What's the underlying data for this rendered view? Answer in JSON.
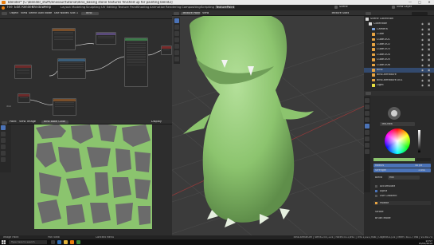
{
  "window": {
    "title": "Blender* [C:\\blender_stuff\\dinosaur\\tutorial\\dino_baking stone textures finished up for painting blend2]",
    "controls": [
      "—",
      "□",
      "✕"
    ]
  },
  "menu": [
    "File",
    "Edit",
    "Render",
    "Window",
    "Help"
  ],
  "workspaces": [
    "Layout",
    "Modeling",
    "Sculpting",
    "UV Editing",
    "Texture Paint",
    "Shading",
    "Animation",
    "Rendering",
    "Compositing",
    "Scripting",
    "TexturePaint"
  ],
  "active_workspace": "TexturePaint",
  "scene": {
    "name": "Scene",
    "view_layer": "View Layer"
  },
  "node_editor": {
    "header": [
      "Object",
      "View",
      "Select",
      "Add",
      "Node",
      "Use Nodes",
      "Slot 1",
      "dino"
    ],
    "material": "dino"
  },
  "image_editor": {
    "header": [
      "Paint",
      "View",
      "Image",
      "dino bake Color"
    ],
    "display": "Display"
  },
  "viewport": {
    "header": [
      "Texture Paint",
      "View",
      "Texture Slots"
    ]
  },
  "outliner": {
    "header": "Scene Collection",
    "items": [
      {
        "name": "Scene Collection",
        "icon": "collection-icon",
        "color": "#d8d8d8"
      },
      {
        "name": "Collection",
        "icon": "collection-icon",
        "color": "#d8d8d8"
      },
      {
        "name": "Camera",
        "icon": "camera-icon",
        "color": "#7a9fd6"
      },
      {
        "name": "Cube",
        "icon": "mesh-icon",
        "color": "#e8a442"
      },
      {
        "name": "Cube.001",
        "icon": "mesh-icon",
        "color": "#e8a442"
      },
      {
        "name": "Cube.002",
        "icon": "mesh-icon",
        "color": "#e8a442"
      },
      {
        "name": "Cube.003",
        "icon": "mesh-icon",
        "color": "#e8a442"
      },
      {
        "name": "Cube.004",
        "icon": "mesh-icon",
        "color": "#e8a442"
      },
      {
        "name": "Cube.005",
        "icon": "mesh-icon",
        "color": "#e8a442"
      },
      {
        "name": "Cube.006",
        "icon": "mesh-icon",
        "color": "#e8a442"
      },
      {
        "name": "dino",
        "icon": "mesh-icon",
        "color": "#e8a442"
      },
      {
        "name": "dino.armature",
        "icon": "armature-icon",
        "color": "#e8a442"
      },
      {
        "name": "dino.armature.001",
        "icon": "armature-icon",
        "color": "#e8a442"
      },
      {
        "name": "Light",
        "icon": "light-icon",
        "color": "#e8e242"
      }
    ]
  },
  "properties": {
    "brush": "TexDraw",
    "radius_label": "Radius",
    "radius_value": "40 px",
    "strength_label": "Strength",
    "strength_value": "1.000",
    "blend_label": "Blend",
    "blend_value": "Mix",
    "sections": [
      "Accumulate",
      "Alpha",
      "Use Gradient"
    ],
    "palette": "Palette",
    "stroke": "Stroke",
    "mode": "Brush Mode"
  },
  "status": {
    "left": [
      "Image Paint",
      "Pan View",
      "Context Menu"
    ],
    "right": "dino.armature | Verts:255,124 | Faces:511,692 | Tris:1,022,946 | Objects:1/14 | Mem: 811.7 MB | v2.80.74"
  },
  "taskbar": {
    "search_placeholder": "Type here to search",
    "time": "13:57",
    "date": "15/02/2019"
  },
  "colors": {
    "accent": "#4b73b8",
    "dino_green": "#8bc46e",
    "mesh_orange": "#e8a442"
  }
}
